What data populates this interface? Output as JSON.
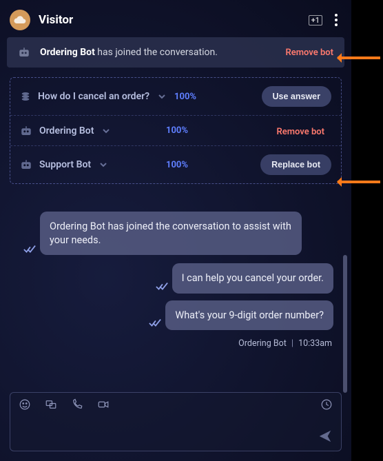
{
  "header": {
    "title": "Visitor",
    "badge": "+1"
  },
  "banner": {
    "bot_name": "Ordering Bot",
    "suffix": " has joined the conversation.",
    "remove_label": "Remove bot"
  },
  "suggestions": [
    {
      "icon": "stack",
      "label": "How do I cancel an order?",
      "confidence": "100%",
      "action_type": "button",
      "action_label": "Use answer"
    },
    {
      "icon": "bot",
      "label": "Ordering Bot",
      "confidence": "100%",
      "action_type": "link",
      "action_label": "Remove bot"
    },
    {
      "icon": "bot",
      "label": "Support Bot",
      "confidence": "100%",
      "action_type": "button",
      "action_label": "Replace bot"
    }
  ],
  "messages": [
    {
      "side": "left",
      "text": "Ordering Bot has joined the conversation to assist with your needs."
    },
    {
      "side": "right",
      "text": "I can help you cancel your order."
    },
    {
      "side": "right",
      "text": "What's your 9-digit order number?"
    }
  ],
  "meta": {
    "sender": "Ordering Bot",
    "time": "10:33am"
  },
  "composer": {
    "placeholder": ""
  }
}
